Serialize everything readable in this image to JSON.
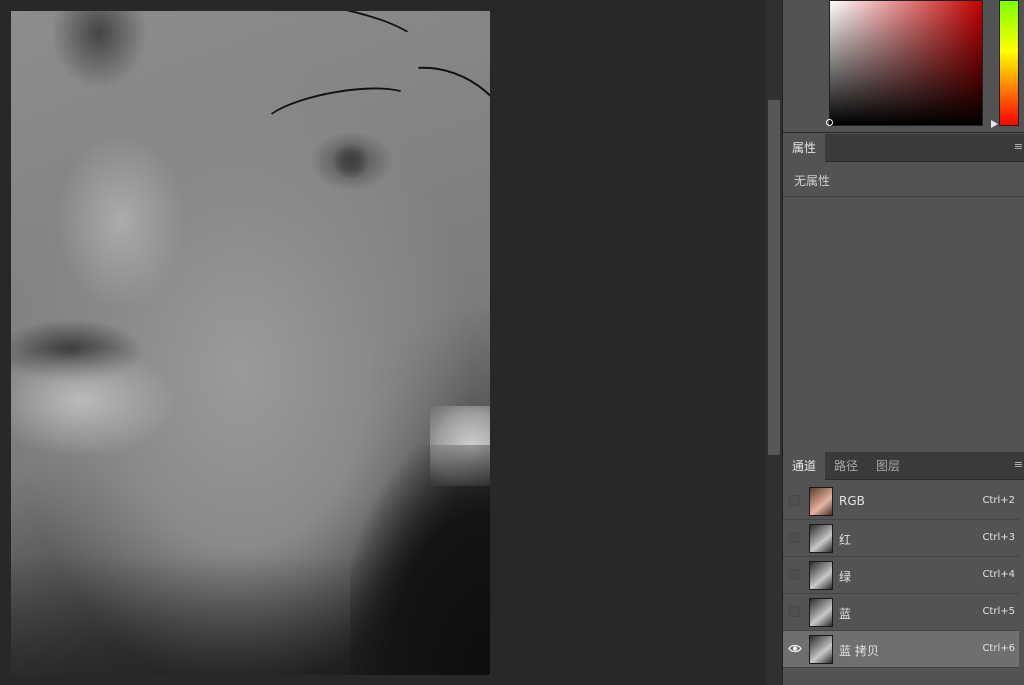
{
  "properties": {
    "tab_label": "属性",
    "empty_text": "无属性"
  },
  "channels_panel": {
    "tabs": [
      {
        "label": "通道",
        "active": true
      },
      {
        "label": "路径",
        "active": false
      },
      {
        "label": "图层",
        "active": false
      }
    ],
    "channels": [
      {
        "name": "RGB",
        "shortcut": "Ctrl+2",
        "visible": false,
        "selected": false
      },
      {
        "name": "红",
        "shortcut": "Ctrl+3",
        "visible": false,
        "selected": false
      },
      {
        "name": "绿",
        "shortcut": "Ctrl+4",
        "visible": false,
        "selected": false
      },
      {
        "name": "蓝",
        "shortcut": "Ctrl+5",
        "visible": false,
        "selected": false
      },
      {
        "name": "蓝 拷贝",
        "shortcut": "Ctrl+6",
        "visible": true,
        "selected": true
      }
    ]
  },
  "icons": {
    "panel_menu": "panel-menu-icon",
    "visibility": "eye-icon"
  },
  "colors": {
    "app_background": "#282828",
    "panel_background": "#535353",
    "tabbar_background": "#3a3a3a",
    "selected_row": "#6f6f6f",
    "color_field_hue": "#c40000"
  }
}
